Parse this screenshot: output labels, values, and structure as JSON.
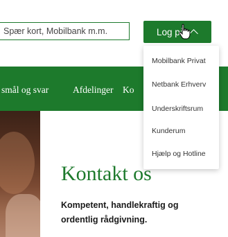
{
  "search": {
    "placeholder": "Spær kort, Mobilbank m.m."
  },
  "login": {
    "label": "Log på"
  },
  "nav": {
    "items": [
      "smål og svar",
      "Afdelinger",
      "Ko"
    ]
  },
  "login_menu": {
    "items": [
      "Mobilbank Privat",
      "Netbank Erhverv",
      "Underskriftsrum",
      "Kunderum",
      "Hjælp og Hotline"
    ]
  },
  "hero": {
    "title": "Kontakt os",
    "subtitle": "Kompetent, handlekraftig og ordentlig rådgivning."
  },
  "colors": {
    "brand_green": "#1d7a2c",
    "menu_bg": "#ffffff"
  },
  "icons": {
    "login_chevron": "chevron-up-icon",
    "cursor": "hand-pointer-icon"
  }
}
